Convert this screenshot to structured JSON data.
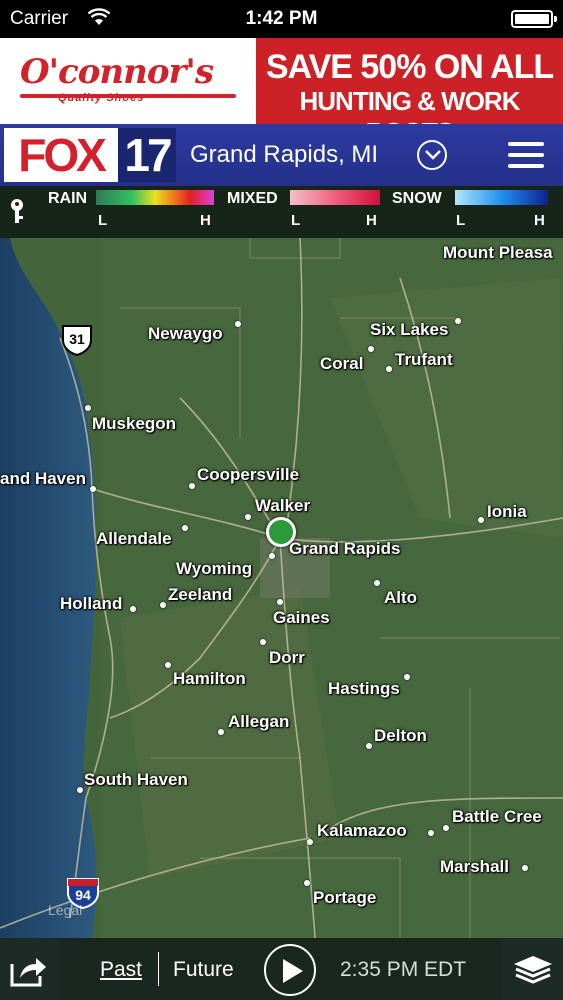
{
  "status_bar": {
    "carrier": "Carrier",
    "time": "1:42 PM"
  },
  "ad": {
    "brand": "O'connor's",
    "brand_tagline": "Quality Shoes",
    "promo_line1": "SAVE 50% ON ALL",
    "promo_line2": "HUNTING & WORK BOOTS",
    "brand_color": "#d2232a"
  },
  "header": {
    "logo_word": "FOX",
    "logo_number": "17",
    "location": "Grand Rapids, MI",
    "accent_color": "#2d3aa0"
  },
  "legend": {
    "rain_label": "RAIN",
    "mixed_label": "MIXED",
    "snow_label": "SNOW",
    "low": "L",
    "high": "H",
    "key_icon": "key-icon"
  },
  "map": {
    "cities": [
      {
        "name": "Mount Pleasa"
      },
      {
        "name": "Newaygo"
      },
      {
        "name": "Six Lakes"
      },
      {
        "name": "Coral"
      },
      {
        "name": "Trufant"
      },
      {
        "name": "Muskegon"
      },
      {
        "name": "and Haven"
      },
      {
        "name": "Coopersville"
      },
      {
        "name": "Walker"
      },
      {
        "name": "Ionia"
      },
      {
        "name": "Allendale"
      },
      {
        "name": "Grand Rapids"
      },
      {
        "name": "Wyoming"
      },
      {
        "name": "Zeeland"
      },
      {
        "name": "Holland"
      },
      {
        "name": "Alto"
      },
      {
        "name": "Gaines"
      },
      {
        "name": "Dorr"
      },
      {
        "name": "Hamilton"
      },
      {
        "name": "Hastings"
      },
      {
        "name": "Allegan"
      },
      {
        "name": "Delton"
      },
      {
        "name": "South Haven"
      },
      {
        "name": "Battle Cree"
      },
      {
        "name": "Kalamazoo"
      },
      {
        "name": "Marshall"
      },
      {
        "name": "Portage"
      }
    ],
    "route_us": "31",
    "route_interstate": "94",
    "legal": "Legal"
  },
  "controls": {
    "past": "Past",
    "future": "Future",
    "timestamp": "2:35 PM EDT"
  }
}
